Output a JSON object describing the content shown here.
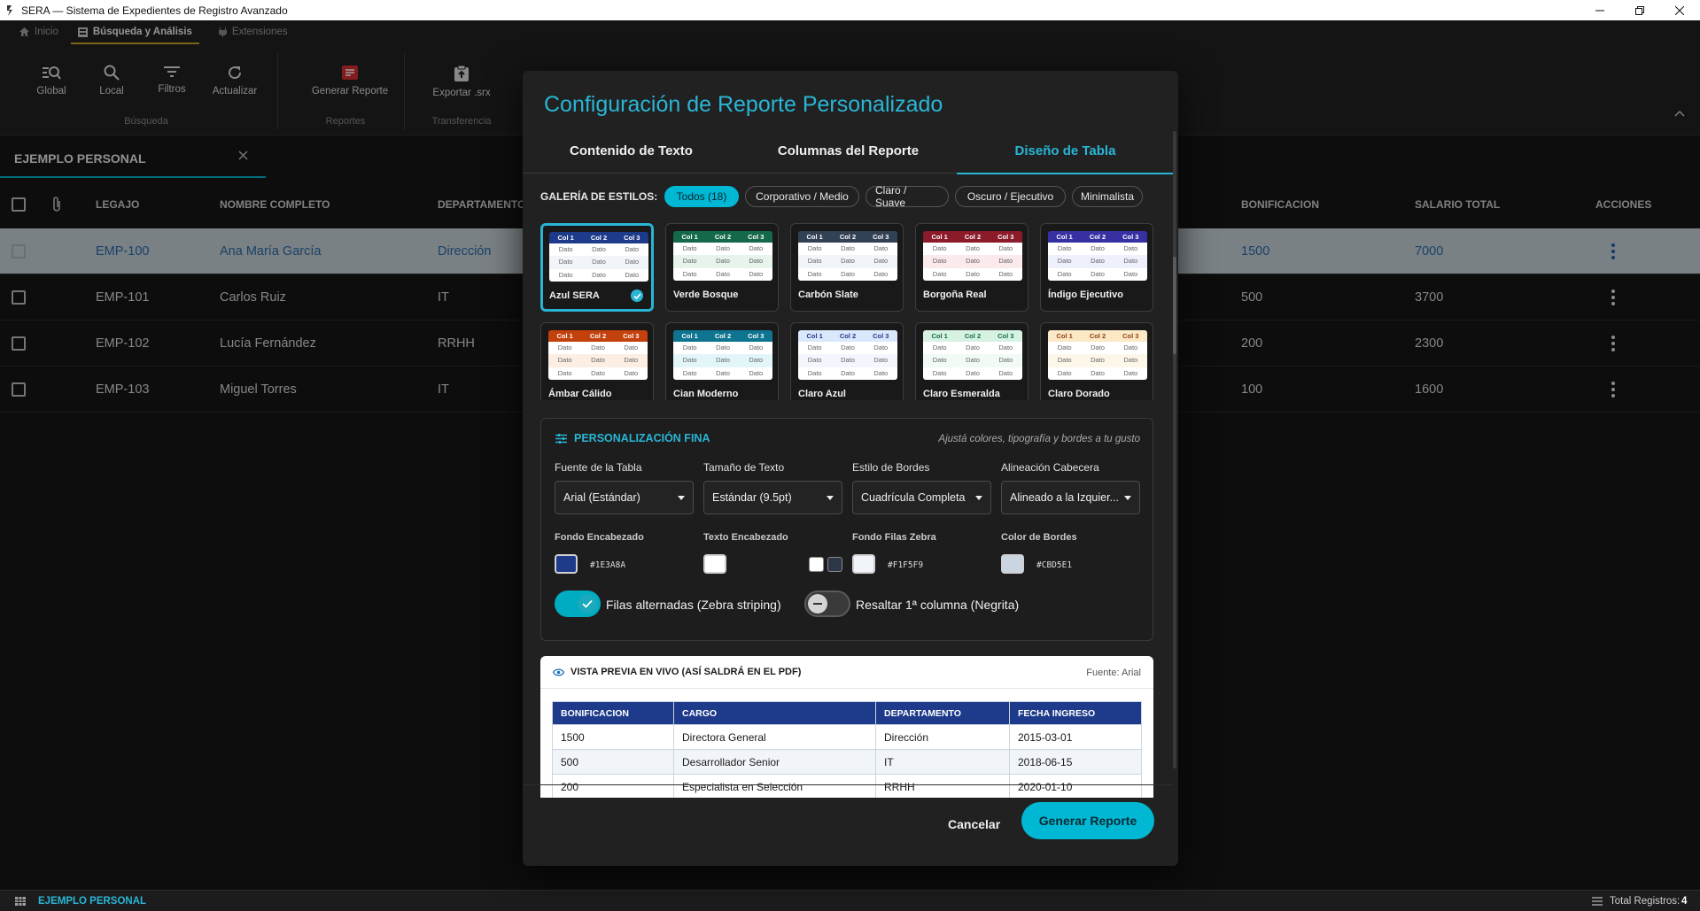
{
  "window": {
    "title": "SERA — Sistema de Expedientes de Registro Avanzado"
  },
  "ribbon": {
    "tabs": [
      "Inicio",
      "Búsqueda y Análisis",
      "Extensiones"
    ],
    "buttons": {
      "global": "Global",
      "local": "Local",
      "filtros": "Filtros",
      "actualizar": "Actualizar",
      "generar": "Generar Reporte",
      "exportar": "Exportar .srx"
    },
    "groups": {
      "busqueda": "Búsqueda",
      "reportes": "Reportes",
      "transferencia": "Transferencia"
    }
  },
  "file_tab": "EJEMPLO PERSONAL",
  "table": {
    "headers": {
      "legajo": "LEGAJO",
      "nombre": "NOMBRE COMPLETO",
      "departamento": "DEPARTAMENTO",
      "bonificacion": "BONIFICACION",
      "salario": "SALARIO TOTAL",
      "acciones": "ACCIONES"
    },
    "rows": [
      {
        "legajo": "EMP-100",
        "nombre": "Ana María García",
        "dept": "Dirección",
        "bonif": "1500",
        "salario": "7000"
      },
      {
        "legajo": "EMP-101",
        "nombre": "Carlos Ruiz",
        "dept": "IT",
        "bonif": "500",
        "salario": "3700"
      },
      {
        "legajo": "EMP-102",
        "nombre": "Lucía Fernández",
        "dept": "RRHH",
        "bonif": "200",
        "salario": "2300"
      },
      {
        "legajo": "EMP-103",
        "nombre": "Miguel Torres",
        "dept": "IT",
        "bonif": "100",
        "salario": "1600"
      }
    ]
  },
  "statusbar": {
    "file": "EJEMPLO PERSONAL",
    "total_label": "Total Registros:",
    "total": "4"
  },
  "dialog": {
    "title": "Configuración de Reporte Personalizado",
    "tabs": [
      "Contenido de Texto",
      "Columnas del Reporte",
      "Diseño de Tabla"
    ],
    "active_tab": "Diseño de Tabla",
    "gallery_label": "GALERÍA DE ESTILOS:",
    "chips": [
      "Todos (18)",
      "Corporativo / Medio",
      "Claro / Suave",
      "Oscuro / Ejecutivo",
      "Minimalista"
    ],
    "mini_header": [
      "Col 1",
      "Col 2",
      "Col 3"
    ],
    "mini_cell": "Dato",
    "styles": [
      {
        "name": "Azul SERA",
        "head": "#1e3a8a",
        "headText": "#ffffff",
        "zebra": "#f1f5f9",
        "selected": true
      },
      {
        "name": "Verde Bosque",
        "head": "#14694a",
        "headText": "#ffffff",
        "zebra": "#e6f4ec"
      },
      {
        "name": "Carbón Slate",
        "head": "#334155",
        "headText": "#ffffff",
        "zebra": "#f1f5f9"
      },
      {
        "name": "Borgoña Real",
        "head": "#8b1a2b",
        "headText": "#ffffff",
        "zebra": "#fbe9ec"
      },
      {
        "name": "Índigo Ejecutivo",
        "head": "#3730a3",
        "headText": "#ffffff",
        "zebra": "#eef0fb"
      },
      {
        "name": "Ámbar Cálido",
        "head": "#c2410c",
        "headText": "#ffffff",
        "zebra": "#fdeee4"
      },
      {
        "name": "Cian Moderno",
        "head": "#0e7490",
        "headText": "#ffffff",
        "zebra": "#e2f6fa"
      },
      {
        "name": "Claro Azul",
        "head": "#dbe7fb",
        "headText": "#1e3a8a",
        "zebra": "#f3f7fd"
      },
      {
        "name": "Claro Esmeralda",
        "head": "#d6f2e2",
        "headText": "#14694a",
        "zebra": "#f1faf5"
      },
      {
        "name": "Claro Dorado",
        "head": "#fbe8c6",
        "headText": "#92400e",
        "zebra": "#fdf7ea"
      }
    ],
    "fine": {
      "title": "PERSONALIZACIÓN FINA",
      "hint": "Ajustá colores, tipografía y bordes a tu gusto",
      "font_label": "Fuente de la Tabla",
      "font_value": "Arial (Estándar)",
      "size_label": "Tamaño de Texto",
      "size_value": "Estándar (9.5pt)",
      "border_label": "Estilo de Bordes",
      "border_value": "Cuadrícula Completa",
      "align_label": "Alineación Cabecera",
      "align_value": "Alineado a la Izquier...",
      "header_bg_label": "Fondo Encabezado",
      "header_bg": "#1E3A8A",
      "header_text_label": "Texto Encabezado",
      "header_text_color": "#FFFFFF",
      "zebra_label": "Fondo Filas Zebra",
      "zebra_color": "#F1F5F9",
      "border_color_label": "Color de Bordes",
      "border_color": "#CBD5E1",
      "toggle1": "Filas alternadas (Zebra striping)",
      "toggle1_on": true,
      "toggle2": "Resaltar 1ª columna (Negrita)",
      "toggle2_on": false
    },
    "preview": {
      "title": "VISTA PREVIA EN VIVO (ASÍ SALDRÁ EN EL PDF)",
      "font": "Fuente: Arial",
      "headers": [
        "BONIFICACION",
        "CARGO",
        "DEPARTAMENTO",
        "FECHA INGRESO"
      ],
      "rows": [
        [
          "1500",
          "Directora General",
          "Dirección",
          "2015-03-01"
        ],
        [
          "500",
          "Desarrollador Senior",
          "IT",
          "2018-06-15"
        ],
        [
          "200",
          "Especialista en Selección",
          "RRHH",
          "2020-01-10"
        ]
      ]
    },
    "cancel": "Cancelar",
    "generate": "Generar Reporte"
  }
}
